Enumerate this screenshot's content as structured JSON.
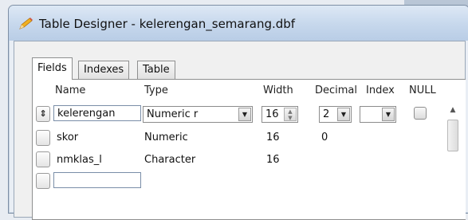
{
  "window": {
    "title": "Table Designer - kelerengan_semarang.dbf"
  },
  "tabs": [
    {
      "label": "Fields",
      "active": true
    },
    {
      "label": "Indexes",
      "active": false
    },
    {
      "label": "Table",
      "active": false
    }
  ],
  "columns": {
    "name": "Name",
    "type": "Type",
    "width": "Width",
    "decimal": "Decimal",
    "index": "Index",
    "null": "NULL"
  },
  "rows": [
    {
      "name": "kelerengan",
      "type": "Numeric r",
      "width": "16",
      "decimal": "2",
      "index": "",
      "null": false,
      "selected": true
    },
    {
      "name": "skor",
      "type": "Numeric",
      "width": "16",
      "decimal": "0"
    },
    {
      "name": "nmklas_l",
      "type": "Character",
      "width": "16",
      "decimal": ""
    },
    {
      "name": "",
      "type": "",
      "width": "",
      "decimal": ""
    }
  ],
  "icons": {
    "title": "pencil-icon",
    "row_mover": "updown-arrows-icon"
  },
  "colors": {
    "titlebar": "#c6d7ec",
    "panel_bg": "#ffffff",
    "input_border": "#7a8ea8"
  }
}
